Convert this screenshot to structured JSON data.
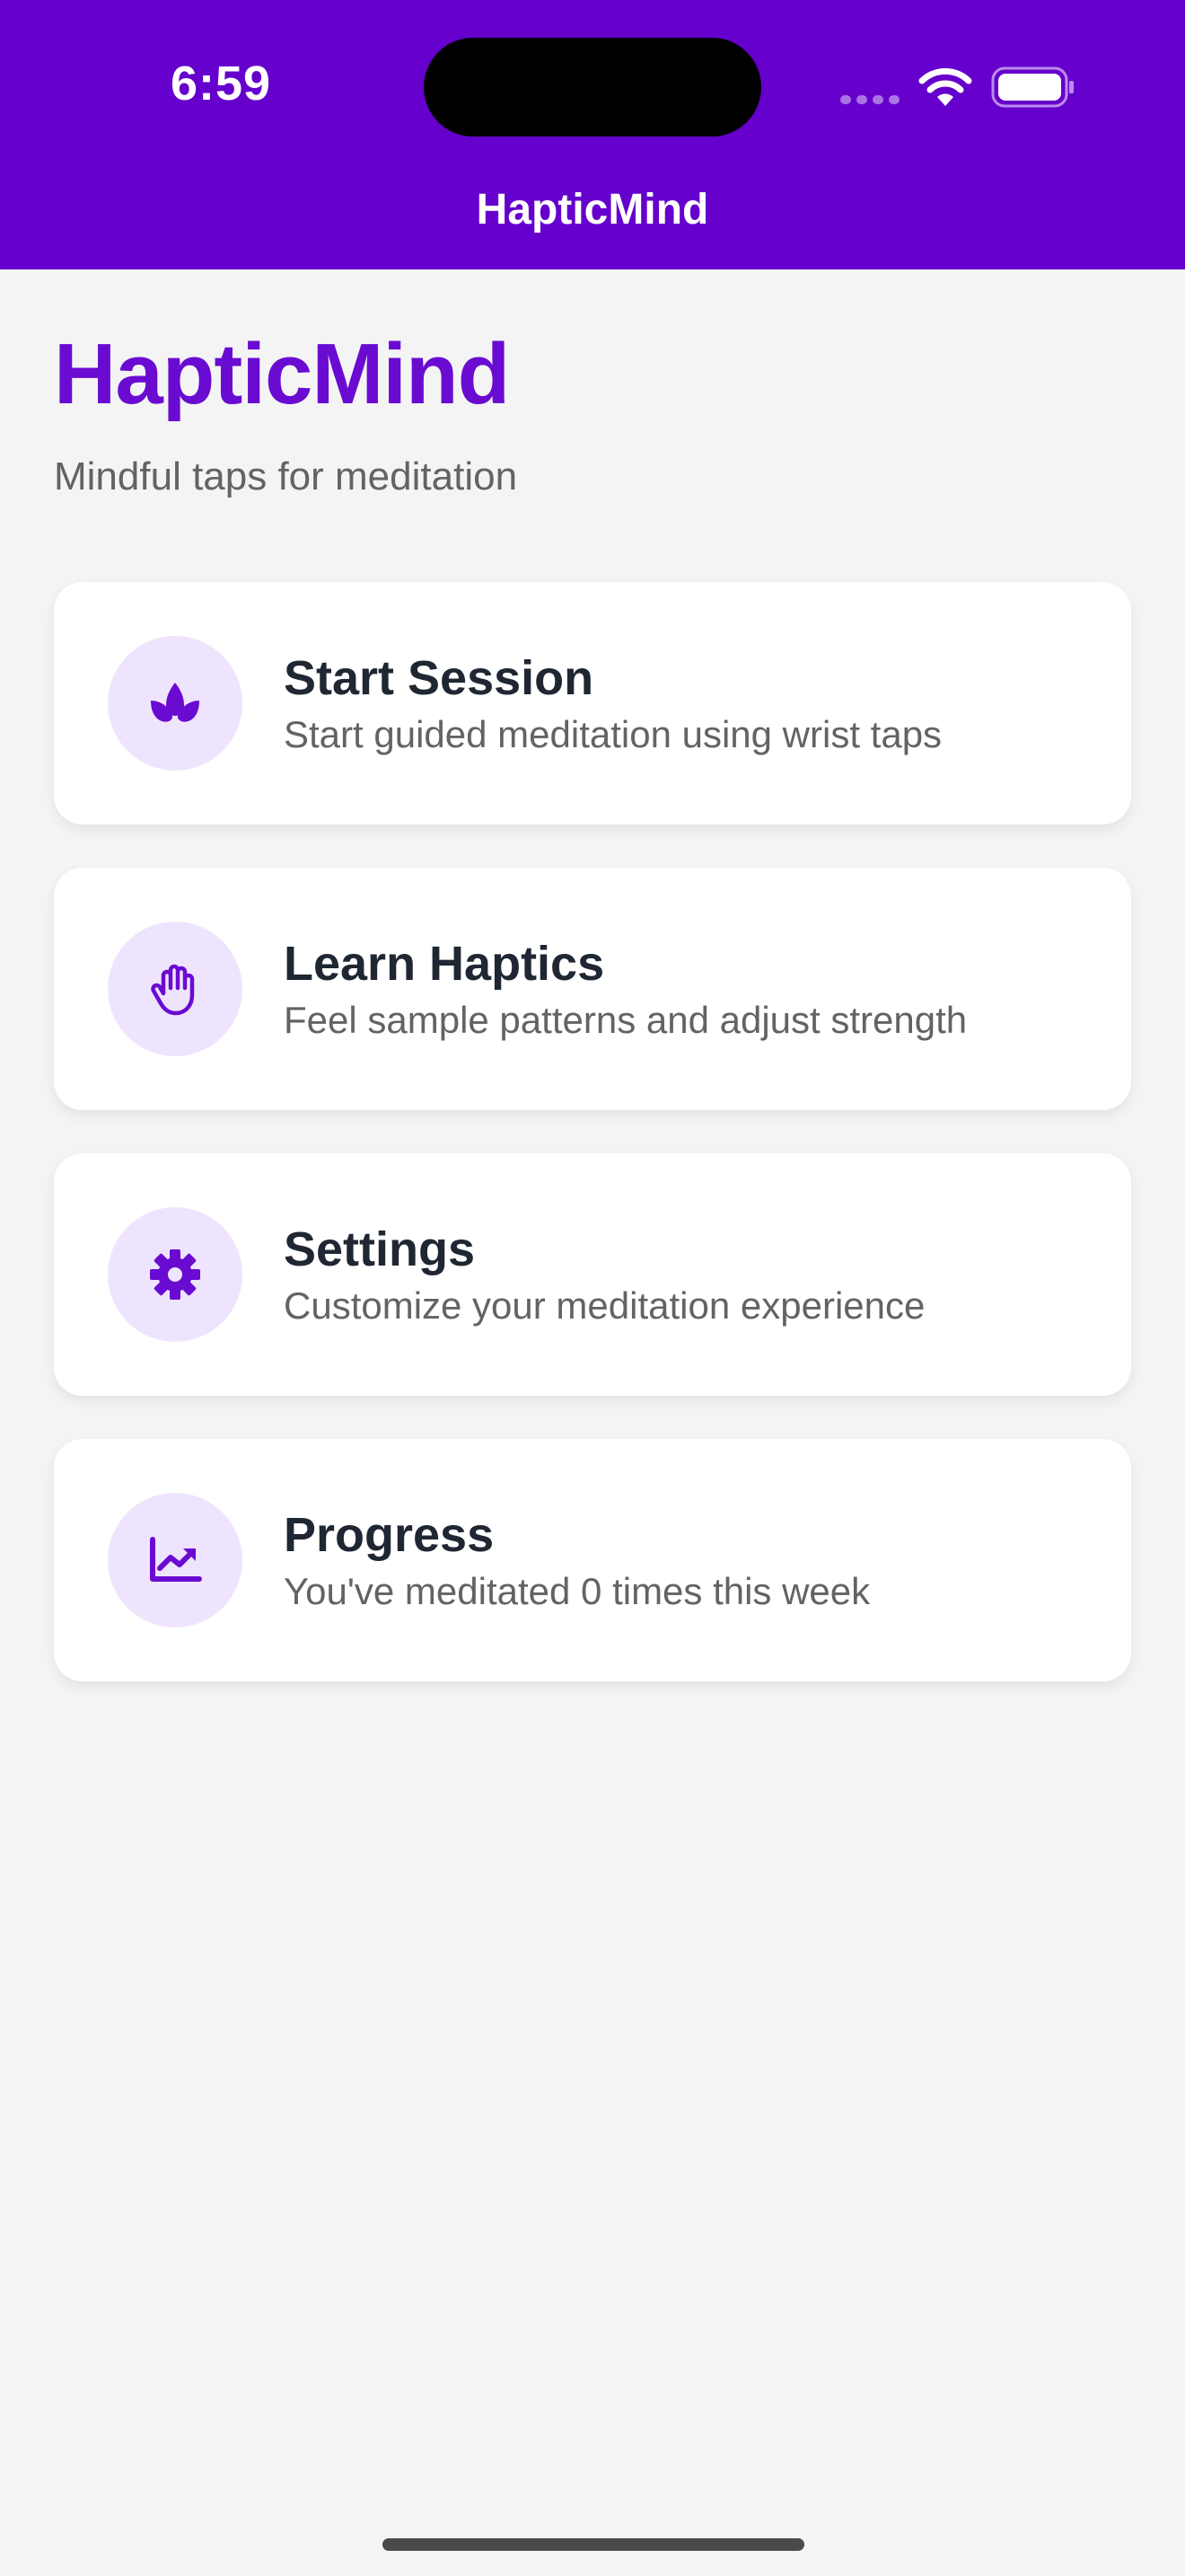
{
  "status_bar": {
    "time": "6:59"
  },
  "nav": {
    "title": "HapticMind"
  },
  "page": {
    "title": "HapticMind",
    "subtitle": "Mindful taps for meditation"
  },
  "cards": [
    {
      "title": "Start Session",
      "description": "Start guided meditation using wrist taps",
      "icon": "lotus-icon"
    },
    {
      "title": "Learn Haptics",
      "description": "Feel sample patterns and adjust strength",
      "icon": "hand-icon"
    },
    {
      "title": "Settings",
      "description": "Customize your meditation experience",
      "icon": "gear-icon"
    },
    {
      "title": "Progress",
      "description": "You've meditated 0 times this week",
      "icon": "chart-icon"
    }
  ],
  "colors": {
    "header": "#6600cc",
    "accent": "#6a0bd1",
    "icon_bg": "#efe4fd",
    "background": "#f4f4f4"
  }
}
